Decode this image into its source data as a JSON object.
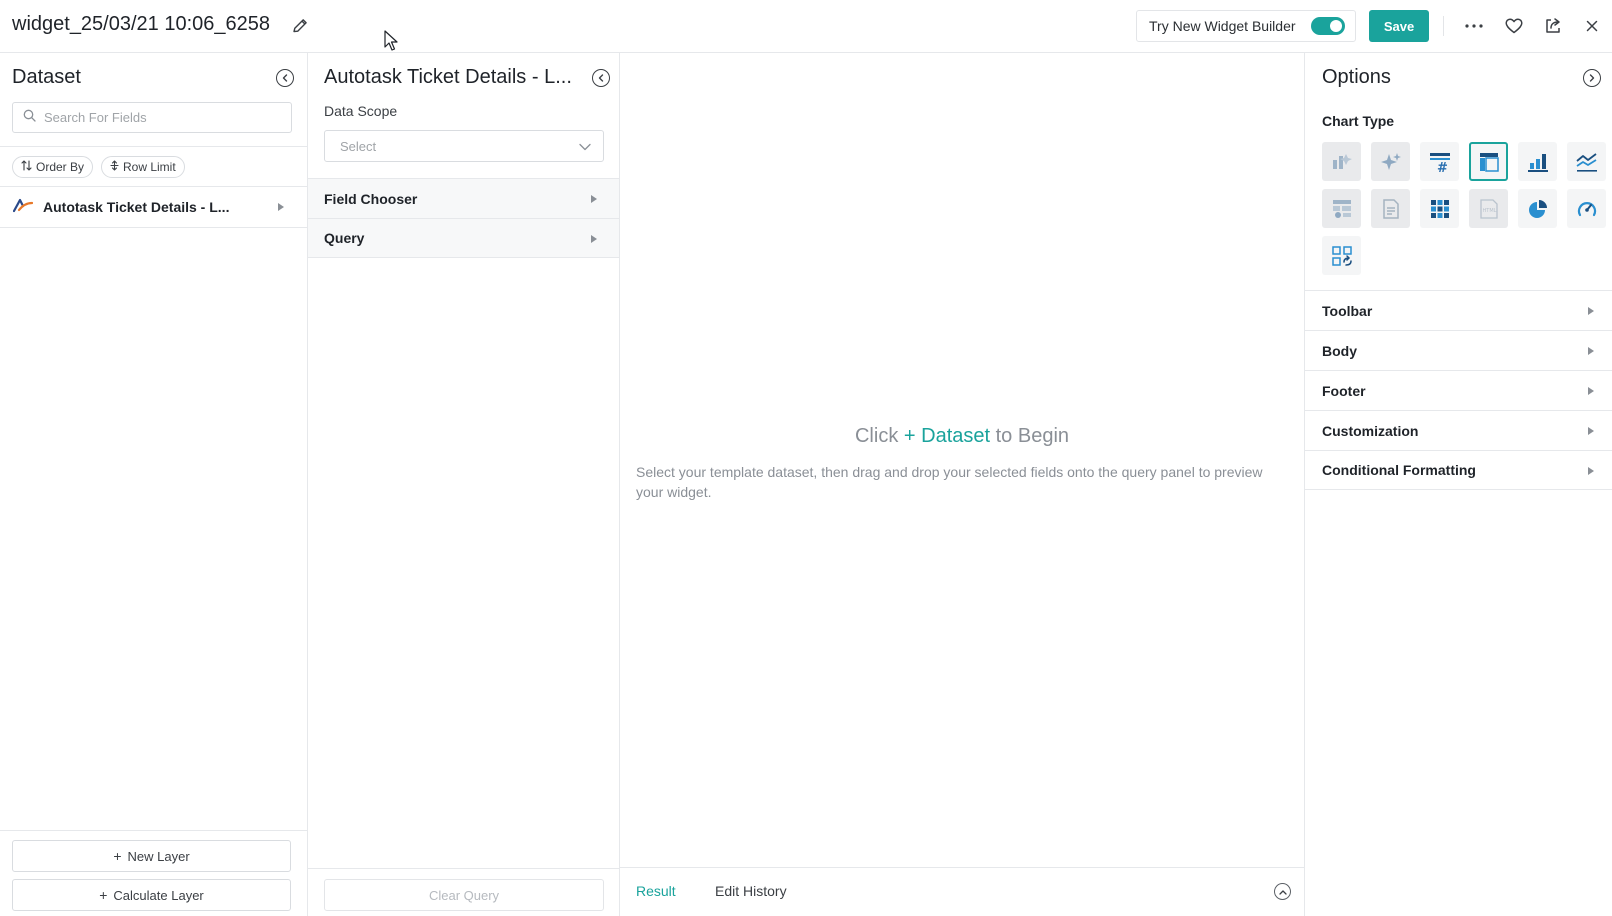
{
  "header": {
    "title": "widget_25/03/21 10:06_6258",
    "try_new_label": "Try New Widget Builder",
    "try_new_enabled": true,
    "save_label": "Save",
    "accent_color": "#1aa39c"
  },
  "dataset_panel": {
    "title": "Dataset",
    "search_placeholder": "Search For Fields",
    "order_by_label": "Order By",
    "row_limit_label": "Row Limit",
    "dataset_item": "Autotask Ticket Details - L...",
    "new_layer_label": "New Layer",
    "calculate_layer_label": "Calculate Layer"
  },
  "query_panel": {
    "title": "Autotask Ticket Details - L...",
    "data_scope_label": "Data Scope",
    "select_placeholder": "Select",
    "field_chooser_label": "Field Chooser",
    "query_label": "Query",
    "clear_query_label": "Clear Query"
  },
  "main": {
    "begin_prefix": "Click",
    "begin_link": "+ Dataset",
    "begin_suffix": "to Begin",
    "help_text": "Select your template dataset, then drag and drop your selected fields onto the query panel to preview your widget.",
    "tabs": [
      "Result",
      "Edit History"
    ],
    "active_tab": "Result"
  },
  "options_panel": {
    "title": "Options",
    "chart_type_label": "Chart Type",
    "chart_types": [
      {
        "name": "smart-chart",
        "state": "disabled"
      },
      {
        "name": "ai-chart",
        "state": "disabled"
      },
      {
        "name": "kpi-number",
        "state": "normal"
      },
      {
        "name": "table",
        "state": "active"
      },
      {
        "name": "bar-chart",
        "state": "normal"
      },
      {
        "name": "line-chart",
        "state": "normal"
      },
      {
        "name": "pivot-table",
        "state": "disabled"
      },
      {
        "name": "text",
        "state": "disabled"
      },
      {
        "name": "heatmap",
        "state": "normal"
      },
      {
        "name": "html",
        "state": "disabled"
      },
      {
        "name": "pie-chart",
        "state": "normal"
      },
      {
        "name": "gauge",
        "state": "normal"
      },
      {
        "name": "custom-visual",
        "state": "normal"
      }
    ],
    "sections": [
      "Toolbar",
      "Body",
      "Footer",
      "Customization",
      "Conditional Formatting"
    ]
  }
}
